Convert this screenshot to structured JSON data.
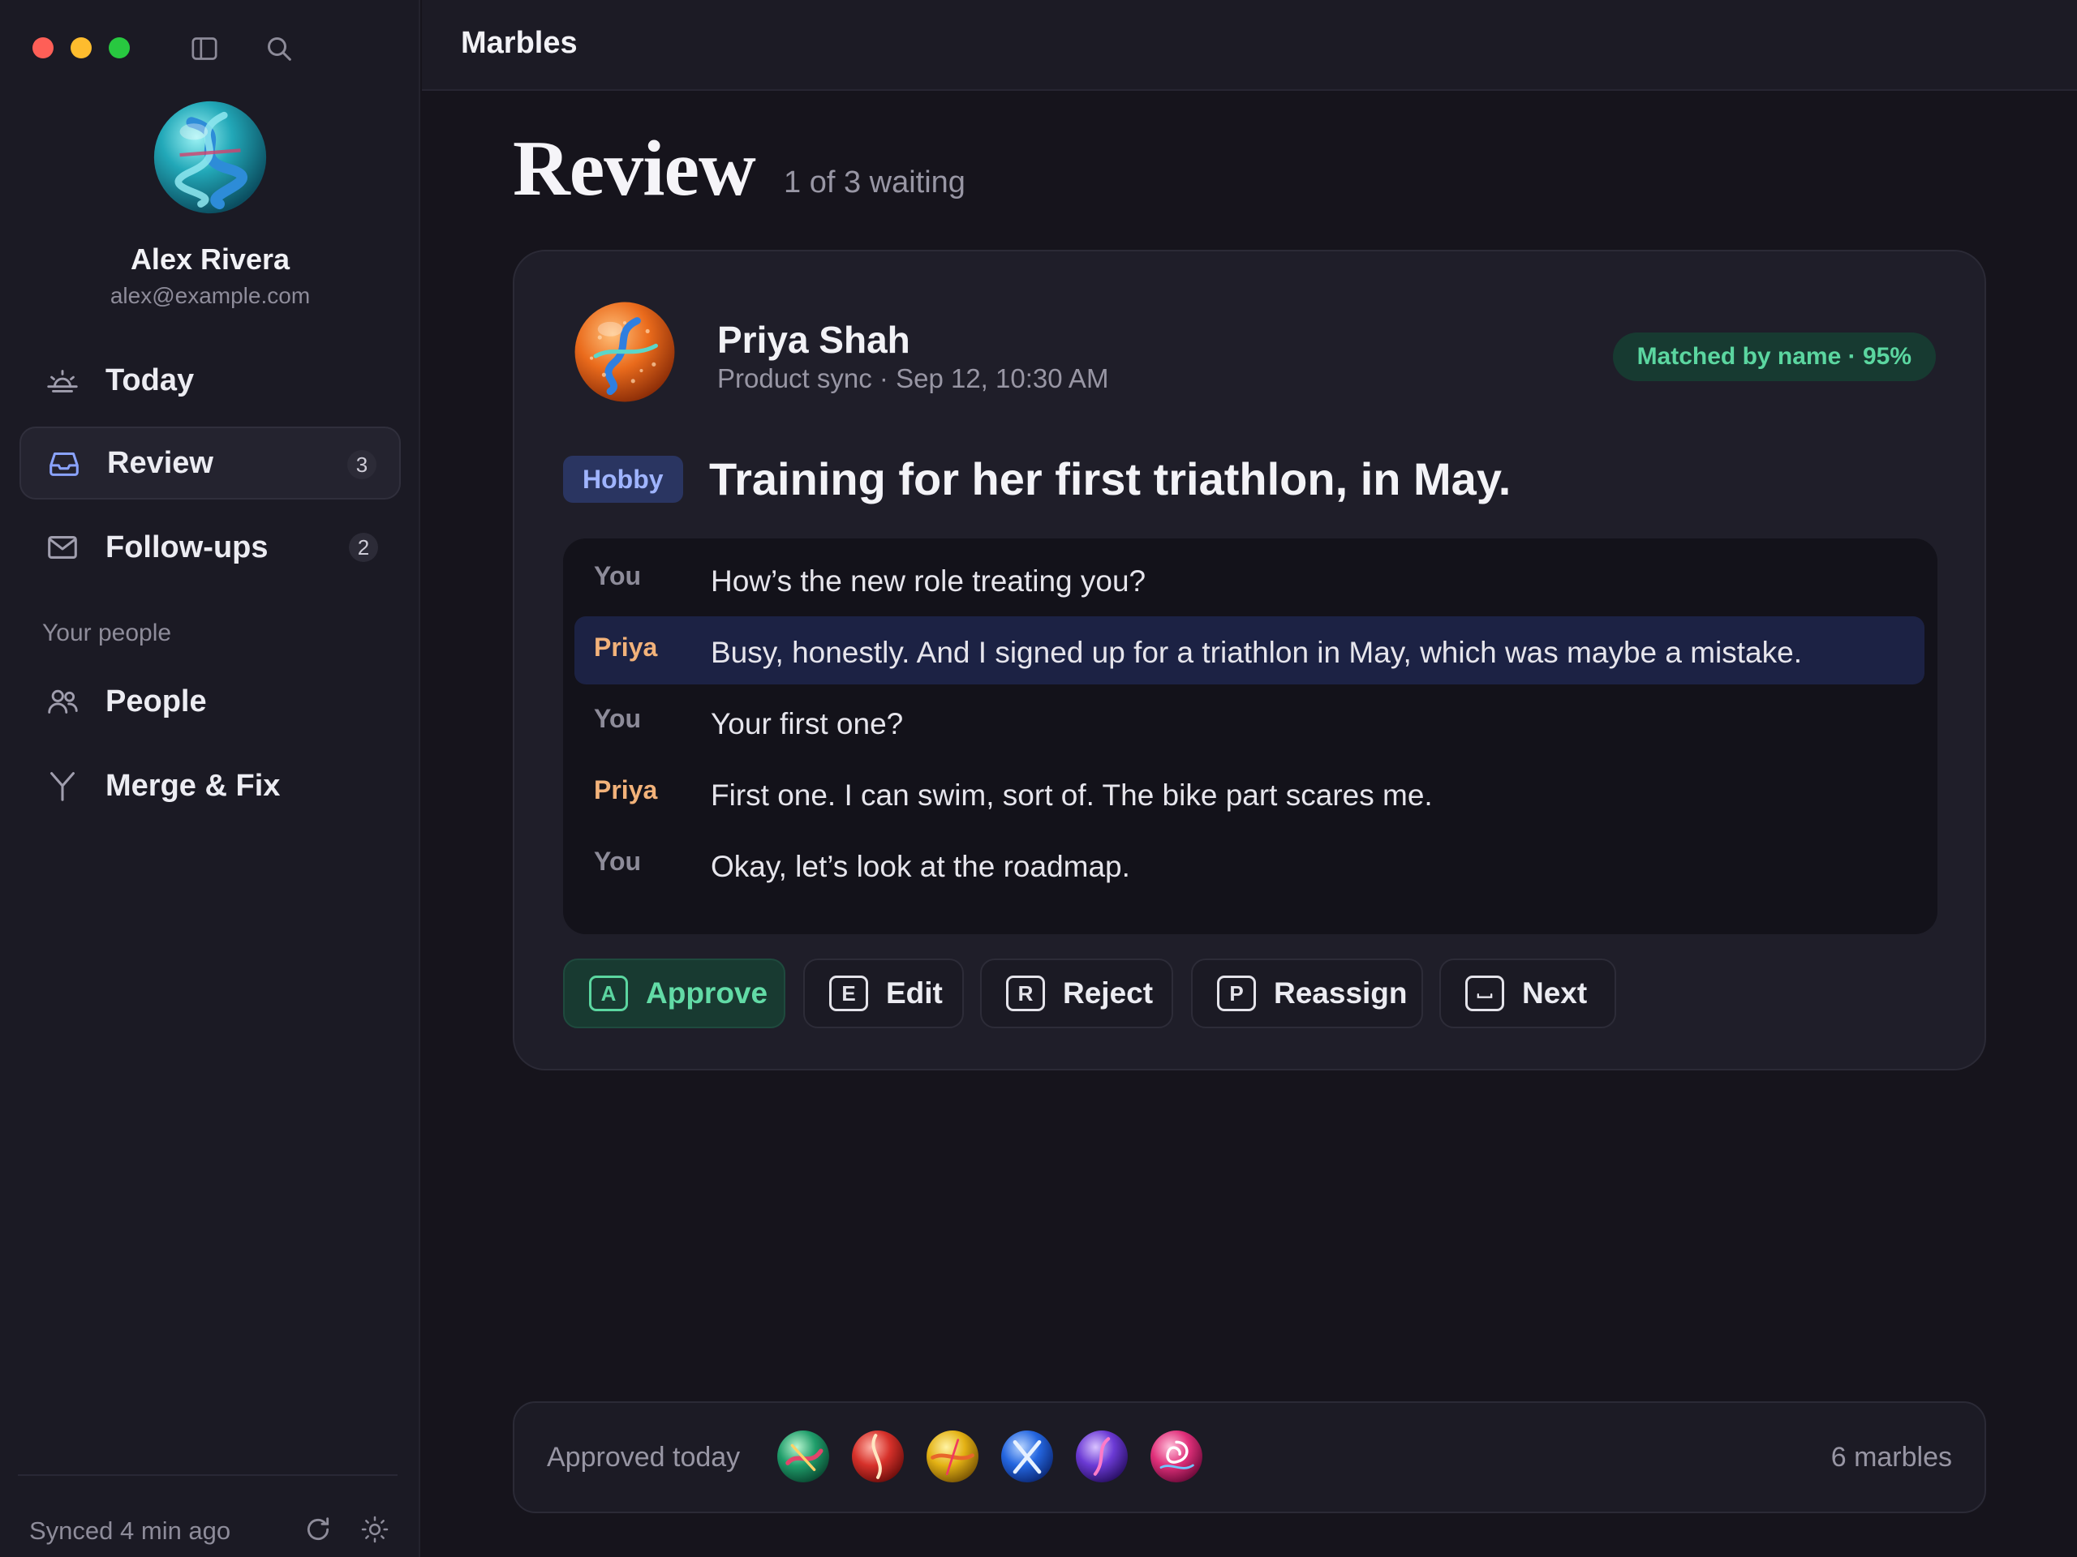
{
  "app": {
    "title": "Marbles"
  },
  "sidebar": {
    "icons": {
      "toggle": "sidebar-toggle-icon",
      "search": "search-icon"
    },
    "user": {
      "name": "Alex Rivera",
      "email": "alex@example.com"
    },
    "nav": [
      {
        "label": "Today",
        "icon": "sunrise-icon",
        "badge": ""
      },
      {
        "label": "Review",
        "icon": "inbox-icon",
        "badge": "3",
        "active": true
      },
      {
        "label": "Follow-ups",
        "icon": "mail-icon",
        "badge": "2"
      }
    ],
    "section_label": "Your people",
    "people_nav": [
      {
        "label": "People",
        "icon": "people-icon"
      },
      {
        "label": "Merge & Fix",
        "icon": "merge-icon"
      }
    ],
    "footer": {
      "sync_status": "Synced 4 min ago",
      "icons": [
        "refresh-icon",
        "theme-sun-icon"
      ]
    }
  },
  "page": {
    "title": "Review",
    "subtitle": "1 of 3 waiting"
  },
  "card": {
    "person": {
      "name": "Priya Shah",
      "meta": "Product sync · Sep 12, 10:30 AM"
    },
    "match_badge": "Matched by name · 95%",
    "tag": "Hobby",
    "headline": "Training for her first triathlon, in May.",
    "transcript": [
      {
        "speaker": "You",
        "text": "How’s the new role treating you?"
      },
      {
        "speaker": "Priya",
        "text": "Busy, honestly. And I signed up for a triathlon in May, which was maybe a mistake.",
        "highlighted": true
      },
      {
        "speaker": "You",
        "text": "Your first one?"
      },
      {
        "speaker": "Priya",
        "text": "First one. I can swim, sort of. The bike part scares me."
      },
      {
        "speaker": "You",
        "text": "Okay, let’s look at the roadmap."
      }
    ],
    "actions": [
      {
        "key": "A",
        "label": "Approve"
      },
      {
        "key": "E",
        "label": "Edit"
      },
      {
        "key": "R",
        "label": "Reject"
      },
      {
        "key": "P",
        "label": "Reassign"
      },
      {
        "key": "␣",
        "label": "Next"
      }
    ]
  },
  "approved": {
    "label": "Approved today",
    "count_label": "6 marbles",
    "marbles": [
      "green",
      "red",
      "yellow",
      "blue",
      "purple",
      "pink"
    ]
  },
  "colors": {
    "accent_green": "#5bd6a0",
    "tag_blue": "#9fb4ff",
    "priya": "#f2b27a",
    "highlight": "#1c2244"
  }
}
